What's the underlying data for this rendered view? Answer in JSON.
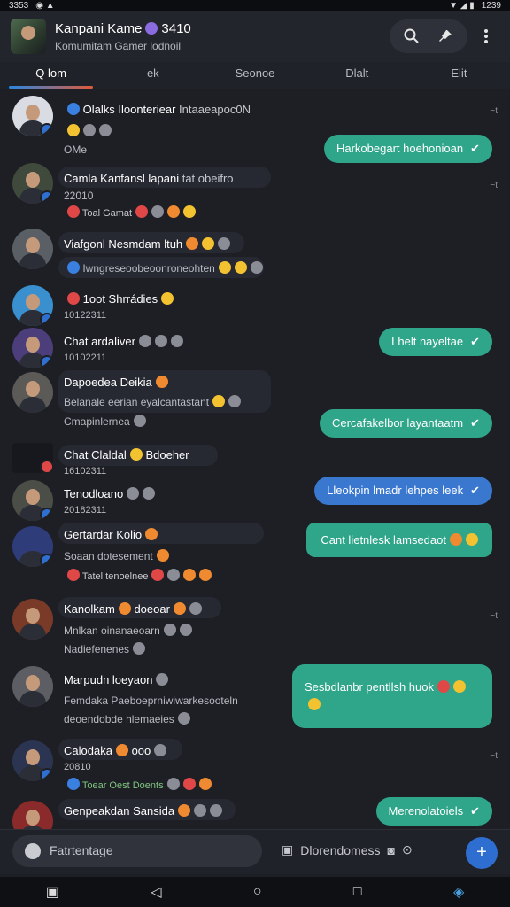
{
  "status": {
    "time_left": "3353",
    "time_right": "1239"
  },
  "header": {
    "title": "Kanpani Kame",
    "title_suffix": "3410",
    "subtitle": "Komumitam Gamer lodnoil"
  },
  "tabs": [
    {
      "label": "Q lom"
    },
    {
      "label": "ek"
    },
    {
      "label": "Seonoe"
    },
    {
      "label": "Dlalt"
    },
    {
      "label": "Elit"
    }
  ],
  "messages": [
    {
      "name": "Olalks Iloonteriear",
      "name_extra": "Intaaeapoc0N",
      "line2": "OMe",
      "bubble": "Harkobegart hoehonioan",
      "time": "~t"
    },
    {
      "name": "Camla Kanfansl lapani",
      "name_extra": "tat obeifro",
      "line2": "22010",
      "line3": "Toal Gamat",
      "time": "~t"
    },
    {
      "name": "Viafgonl Nesmdam ltuh",
      "line2": "Iwngreseoobeoonroneohten"
    },
    {
      "name": "1oot Shrrádies",
      "line2": "10122311"
    },
    {
      "name": "Chat ardaliver",
      "line2": "10102211",
      "bubble": "Lhelt nayeltae"
    },
    {
      "name": "Dapoedea Deikia",
      "line2": "Belanale eerian eyalcantastant",
      "line3": "Cmapinlernea",
      "bubble": "Cercafakelbor layantaatm"
    },
    {
      "name": "Chat Claldal",
      "name_extra": "Bdoeher",
      "line2": "16102311"
    },
    {
      "name": "Tenodloano",
      "line2": "20182311",
      "bubble": "Lleokpin lmadr lehpes leek"
    },
    {
      "name": "Gertardar Kolio",
      "line2": "Soaan dotesement",
      "line3": "Tatel tenoelnee",
      "bubble": "Cant lietnlesk lamsedaot"
    },
    {
      "name": "Kanolkam",
      "name_extra": "doeoar",
      "line2": "Mnlkan oinanaeoarn",
      "line3": "Nadiefenenes",
      "time": "~t"
    },
    {
      "name": "Marpudn loeyaon",
      "line2": "Femdaka Paeboeprniwiwarkesooteln",
      "line3": "deoendobde hlemaeies",
      "bubble": "Sesbdlanbr pentllsh huok"
    },
    {
      "name": "Calodaka",
      "name_extra": "ooo",
      "line2": "20810",
      "line3": "Toear Oest Doents",
      "time": "~t"
    },
    {
      "name": "Genpeakdan Sansida",
      "line2": "",
      "bubble": "Merenolatoiels"
    }
  ],
  "composer": {
    "placeholder": "Fatrtentage",
    "tool_label": "Dlorendomess",
    "send_icon": "+"
  },
  "colors": {
    "accent_green": "#2fa58a",
    "accent_blue": "#3a78d0",
    "background": "#1d1f25"
  }
}
